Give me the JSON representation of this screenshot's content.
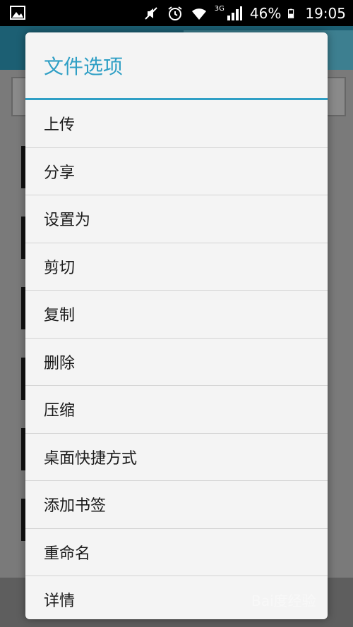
{
  "status_bar": {
    "network": "3G",
    "battery": "46%",
    "time": "19:05",
    "icons": [
      "image-icon",
      "mute-icon",
      "alarm-icon",
      "wifi-icon",
      "signal-icon",
      "battery-icon"
    ]
  },
  "dialog": {
    "title": "文件选项",
    "items": [
      {
        "label": "上传"
      },
      {
        "label": "分享"
      },
      {
        "label": "设置为"
      },
      {
        "label": "剪切"
      },
      {
        "label": "复制"
      },
      {
        "label": "删除"
      },
      {
        "label": "压缩"
      },
      {
        "label": "桌面快捷方式"
      },
      {
        "label": "添加书签"
      },
      {
        "label": "重命名"
      },
      {
        "label": "详情"
      }
    ]
  },
  "watermark": {
    "text": "Bai度经验"
  },
  "colors": {
    "accent": "#2f9fc5",
    "dialog_bg": "#f4f4f4",
    "divider": "#d3d3d3"
  }
}
